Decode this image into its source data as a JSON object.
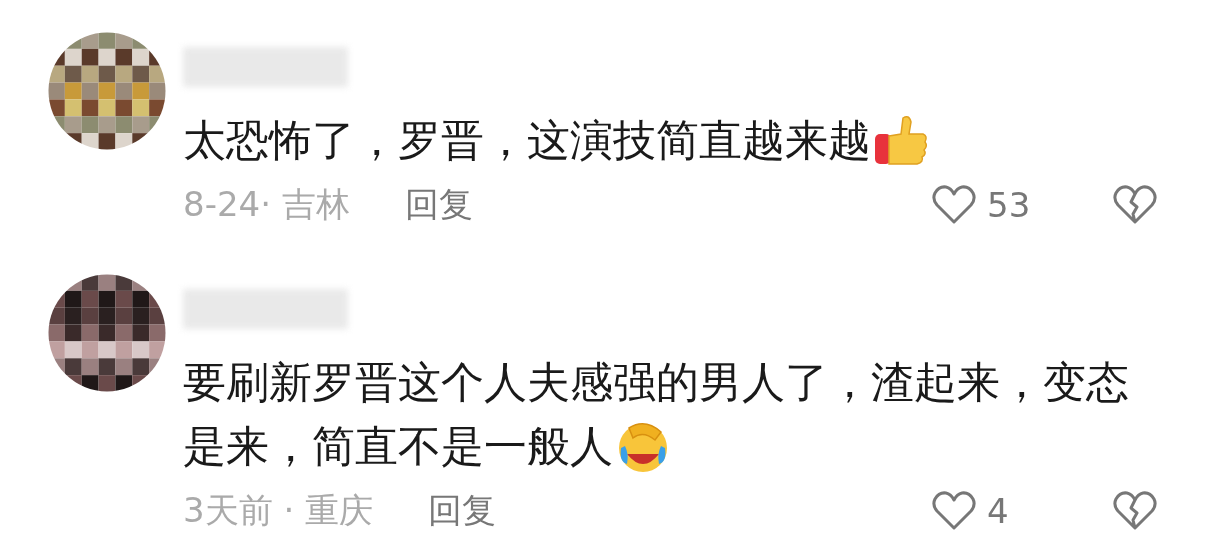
{
  "comments": [
    {
      "lines": [
        "太恐怖了，罗晋，这演技简直越来越"
      ],
      "emoji": {
        "kind": "thumbs-up"
      },
      "date_location": "8-24· 吉林",
      "reply": "回复",
      "likes": "53"
    },
    {
      "lines": [
        "要刷新罗晋这个人夫感强的男人了，渣起来，变态",
        "是来，简直不是一般人"
      ],
      "emoji": {
        "kind": "laughing"
      },
      "date_location": "3天前 · 重庆",
      "reply": "回复",
      "likes": "4"
    }
  ]
}
